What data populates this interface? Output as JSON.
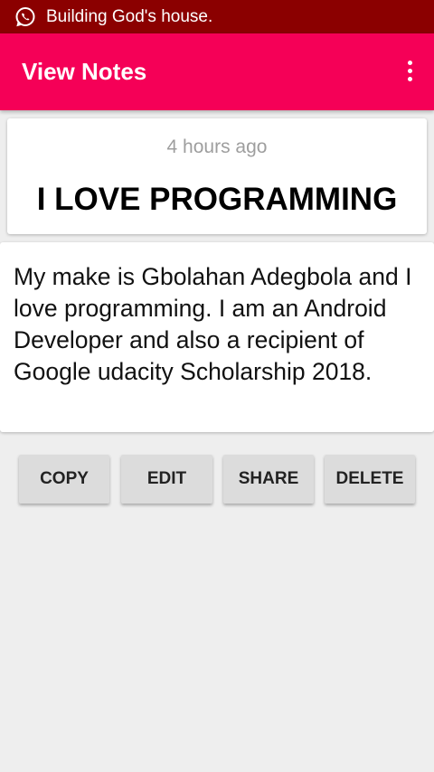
{
  "status_bar": {
    "icon": "whatsapp-icon",
    "text": "Building God's house.",
    "color": "#8b0000"
  },
  "app_bar": {
    "title": "View Notes",
    "menu_icon": "more-vert-icon",
    "color": "#f50057"
  },
  "note": {
    "timestamp": "4 hours ago",
    "title": "I LOVE PROGRAMMING",
    "body": "My make is Gbolahan Adegbola and I love programming. I am an Android Developer and also a recipient of Google udacity Scholarship 2018."
  },
  "actions": {
    "copy_label": "COPY",
    "edit_label": "EDIT",
    "share_label": "SHARE",
    "delete_label": "DELETE"
  }
}
